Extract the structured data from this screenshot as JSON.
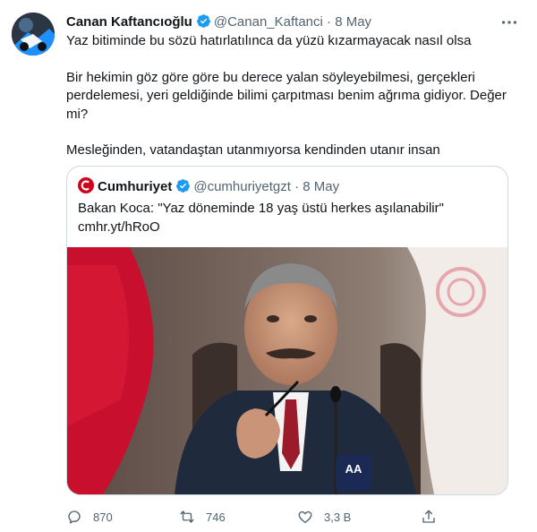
{
  "tweet": {
    "author_name": "Canan Kaftancıoğlu",
    "author_handle": "@Canan_Kaftanci",
    "separator": "·",
    "date": "8 May",
    "lines": [
      "Yaz bitiminde bu sözü hatırlatılınca da yüzü kızarmayacak nasıl olsa",
      "Bir hekimin göz göre göre bu derece yalan söyleyebilmesi, gerçekleri perdelemesi, yeri geldiğinde bilimi çarpıtması benim ağrıma gidiyor. Değer mi?",
      "Mesleğinden, vatandaştan utanmıyorsa kendinden utanır insan"
    ]
  },
  "quoted": {
    "author_name": "Cumhuriyet",
    "author_handle": "@cumhuriyetgzt",
    "separator": "·",
    "date": "8 May",
    "text": "Bakan Koca: \"Yaz döneminde 18 yaş üstü herkes aşılanabilir\"",
    "link": "cmhr.yt/hRoO",
    "image_alt_logo": "AA"
  },
  "actions": {
    "reply_count": "870",
    "retweet_count": "746",
    "like_count": "3,3 B"
  },
  "colors": {
    "verified": "#1d9bf0",
    "muted": "#536471",
    "cumhuriyet_red": "#d0021b"
  }
}
